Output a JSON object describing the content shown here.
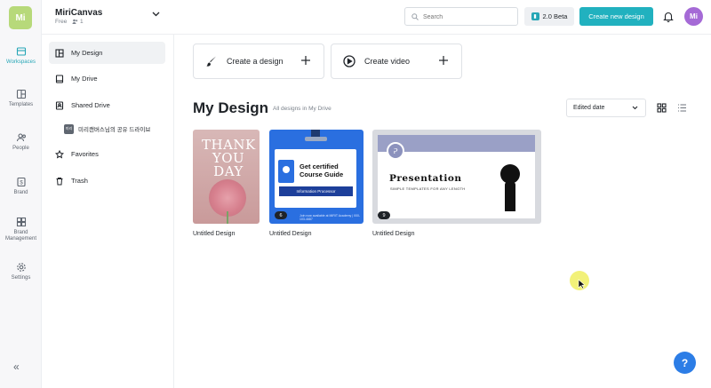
{
  "brand": {
    "logo_text": "Mi",
    "accent": "#21b1bf"
  },
  "rail": {
    "items": [
      {
        "label": "Workspaces",
        "icon": "workspaces-icon"
      },
      {
        "label": "Templates",
        "icon": "templates-icon"
      },
      {
        "label": "People",
        "icon": "people-icon"
      },
      {
        "label": "Brand",
        "icon": "brand-icon"
      },
      {
        "label": "Brand Management",
        "icon": "brand-management-icon"
      },
      {
        "label": "Settings",
        "icon": "gear-icon"
      }
    ],
    "collapse_label": "«"
  },
  "header": {
    "workspace_name": "MiriCanvas",
    "plan": "Free",
    "member_count": "1",
    "search_placeholder": "Search",
    "beta_label": "2.0 Beta",
    "create_label": "Create new design",
    "avatar_initials": "Mi"
  },
  "sidenav": {
    "items": [
      {
        "label": "My Design"
      },
      {
        "label": "My Drive"
      },
      {
        "label": "Shared Drive"
      },
      {
        "label": "Favorites"
      },
      {
        "label": "Trash"
      }
    ],
    "shared_sub": {
      "badge": "미리",
      "label": "미리캔버스님의 공유 드라이브"
    }
  },
  "main": {
    "create_a_design": "Create a design",
    "create_video": "Create video",
    "title": "My Design",
    "subtitle": "All designs in My Drive",
    "sort_label": "Edited date",
    "designs": [
      {
        "label": "Untitled Design",
        "page_count": "",
        "art_text": "THANK YOU DAY"
      },
      {
        "label": "Untitled Design",
        "page_count": "6",
        "art_title": "Get certified Course Guide",
        "art_tag": "Information Processor",
        "art_footer": "Join now available at MIRIT Academy | 000-103-4687"
      },
      {
        "label": "Untitled Design",
        "page_count": "9",
        "art_title": "Presentation",
        "art_sub": "SIMPLE TEMPLATES FOR ANY LENGTH"
      }
    ]
  },
  "help_label": "?"
}
